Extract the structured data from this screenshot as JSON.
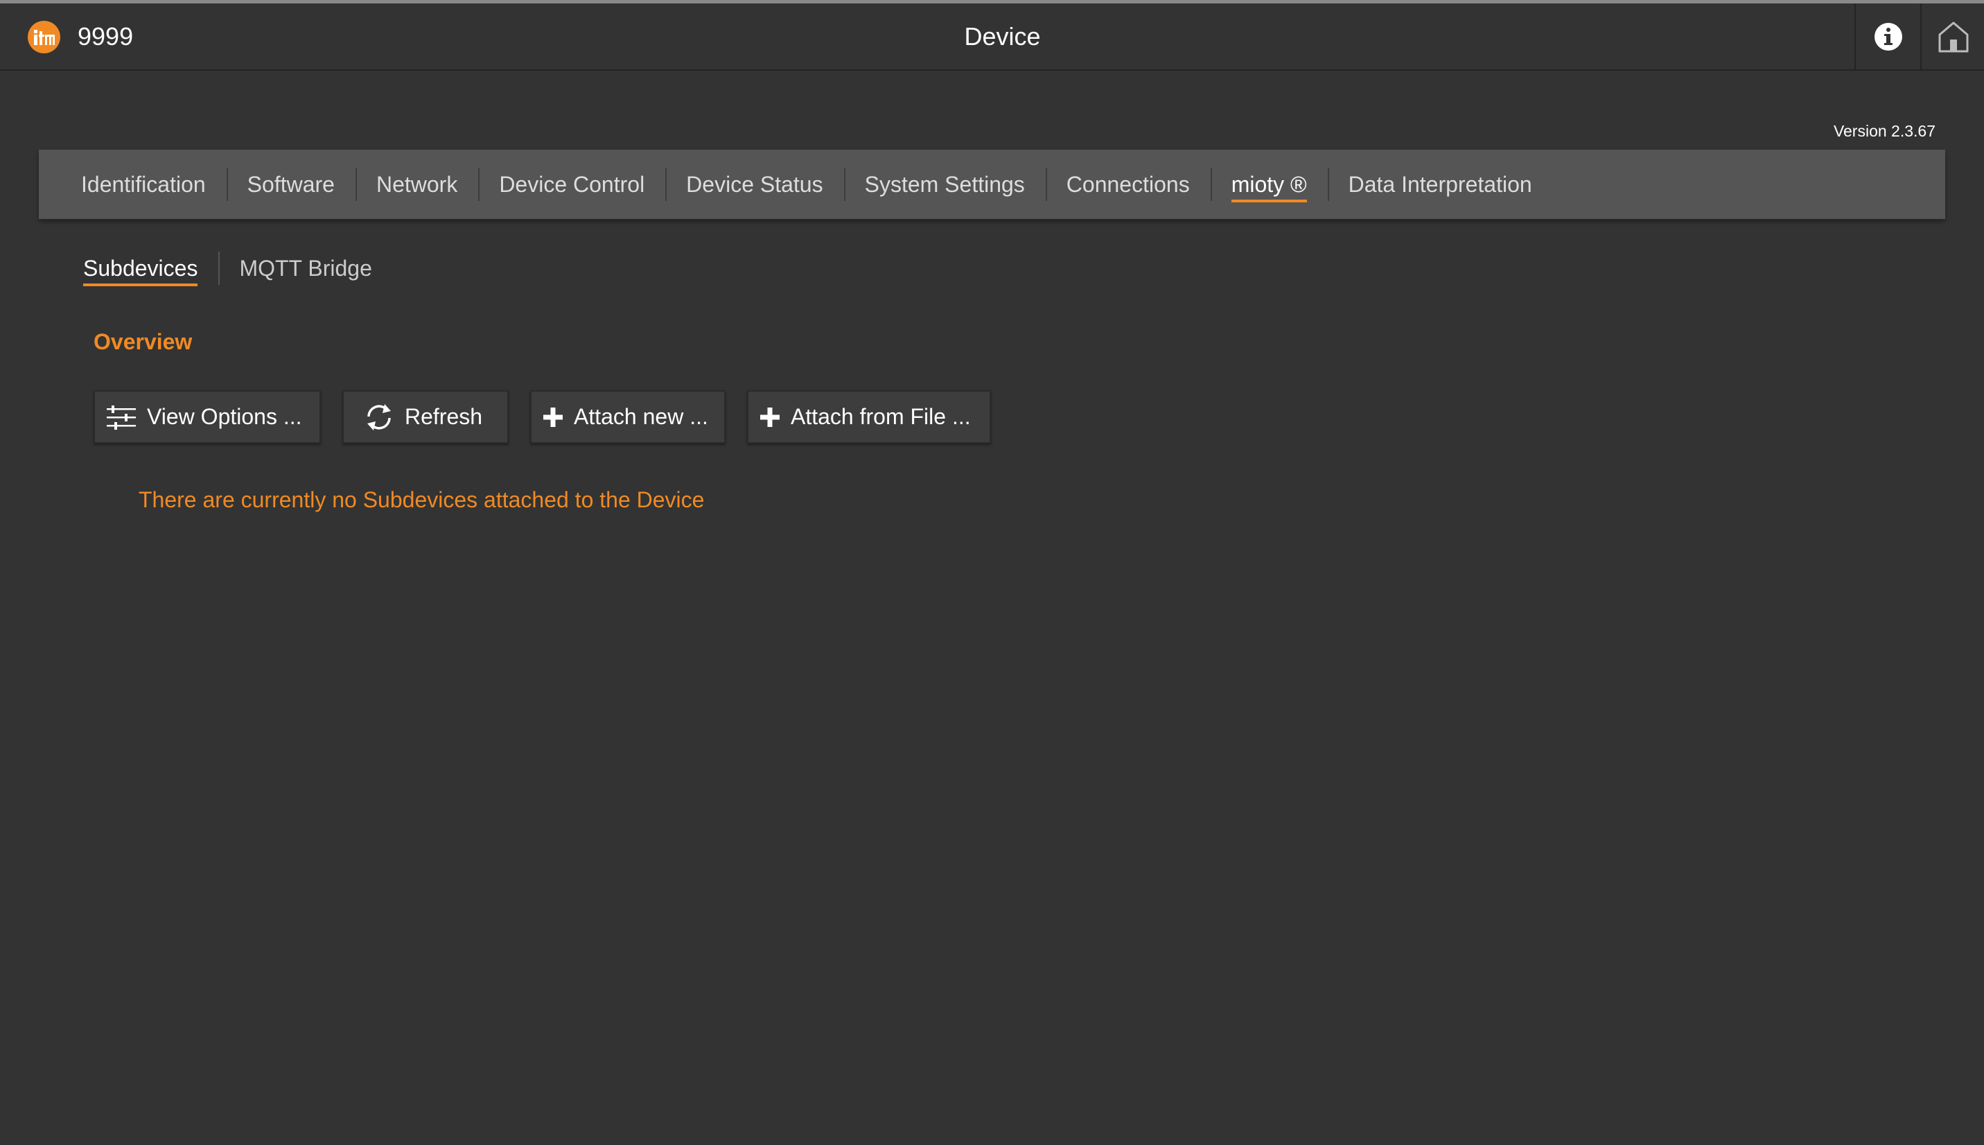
{
  "header": {
    "device_id": "9999",
    "title": "Device",
    "logo_icon": "ifm-logo-icon",
    "info_icon": "info-icon",
    "home_icon": "home-icon"
  },
  "version": "Version 2.3.67",
  "tabs": [
    {
      "label": "Identification",
      "active": false
    },
    {
      "label": "Software",
      "active": false
    },
    {
      "label": "Network",
      "active": false
    },
    {
      "label": "Device Control",
      "active": false
    },
    {
      "label": "Device Status",
      "active": false
    },
    {
      "label": "System Settings",
      "active": false
    },
    {
      "label": "Connections",
      "active": false
    },
    {
      "label": "mioty ®",
      "active": true
    },
    {
      "label": "Data Interpretation",
      "active": false
    }
  ],
  "subtabs": [
    {
      "label": "Subdevices",
      "active": true
    },
    {
      "label": "MQTT Bridge",
      "active": false
    }
  ],
  "section_title": "Overview",
  "buttons": {
    "view_options": "View Options ...",
    "refresh": "Refresh",
    "attach_new": "Attach new ...",
    "attach_file": "Attach from File ..."
  },
  "empty_message": "There are currently no Subdevices attached to the Device",
  "colors": {
    "accent": "#f08a24",
    "background": "#333333",
    "tabbar": "#555555"
  }
}
